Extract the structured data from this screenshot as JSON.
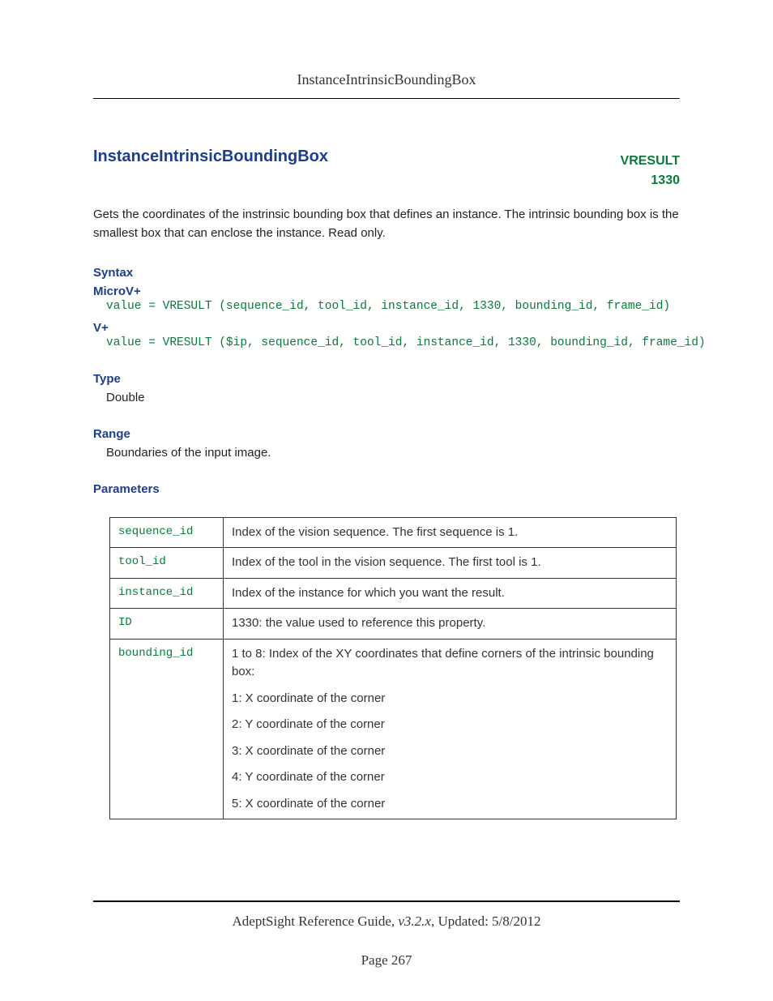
{
  "header": {
    "title": "InstanceIntrinsicBoundingBox"
  },
  "main": {
    "heading": "InstanceIntrinsicBoundingBox",
    "tag1": "VRESULT",
    "tag2": "1330",
    "intro": "Gets the coordinates of the instrinsic bounding box that defines an instance. The intrinsic bounding box is the smallest box that can enclose the instance. Read only."
  },
  "syntax": {
    "label": "Syntax",
    "microv_label": "MicroV+",
    "microv_code": "value = VRESULT (sequence_id, tool_id, instance_id, 1330, bounding_id, frame_id)",
    "vplus_label": "V+",
    "vplus_code": "value = VRESULT ($ip, sequence_id, tool_id, instance_id, 1330, bounding_id, frame_id)"
  },
  "type": {
    "label": "Type",
    "value": "Double"
  },
  "range": {
    "label": "Range",
    "value": "Boundaries of the input image."
  },
  "parameters": {
    "label": "Parameters",
    "rows": [
      {
        "name": "sequence_id",
        "desc": "Index of the vision sequence. The first sequence is 1."
      },
      {
        "name": "tool_id",
        "desc": "Index of the tool in the vision sequence. The first tool is 1."
      },
      {
        "name": "instance_id",
        "desc": "Index of the instance for which you want the result."
      },
      {
        "name": "ID",
        "desc": "1330: the value used to reference this property."
      }
    ],
    "bounding": {
      "name": "bounding_id",
      "intro": "1 to 8: Index of the XY coordinates that define corners of the intrinsic bounding box:",
      "lines": [
        "1: X coordinate of the corner",
        "2: Y coordinate of the corner",
        "3: X coordinate of the corner",
        "4: Y coordinate of the corner",
        "5: X coordinate of the corner"
      ]
    }
  },
  "footer": {
    "guide": "AdeptSight Reference Guide",
    "version": ", v3.2.x",
    "updated": ", Updated: 5/8/2012",
    "page": "Page 267"
  }
}
